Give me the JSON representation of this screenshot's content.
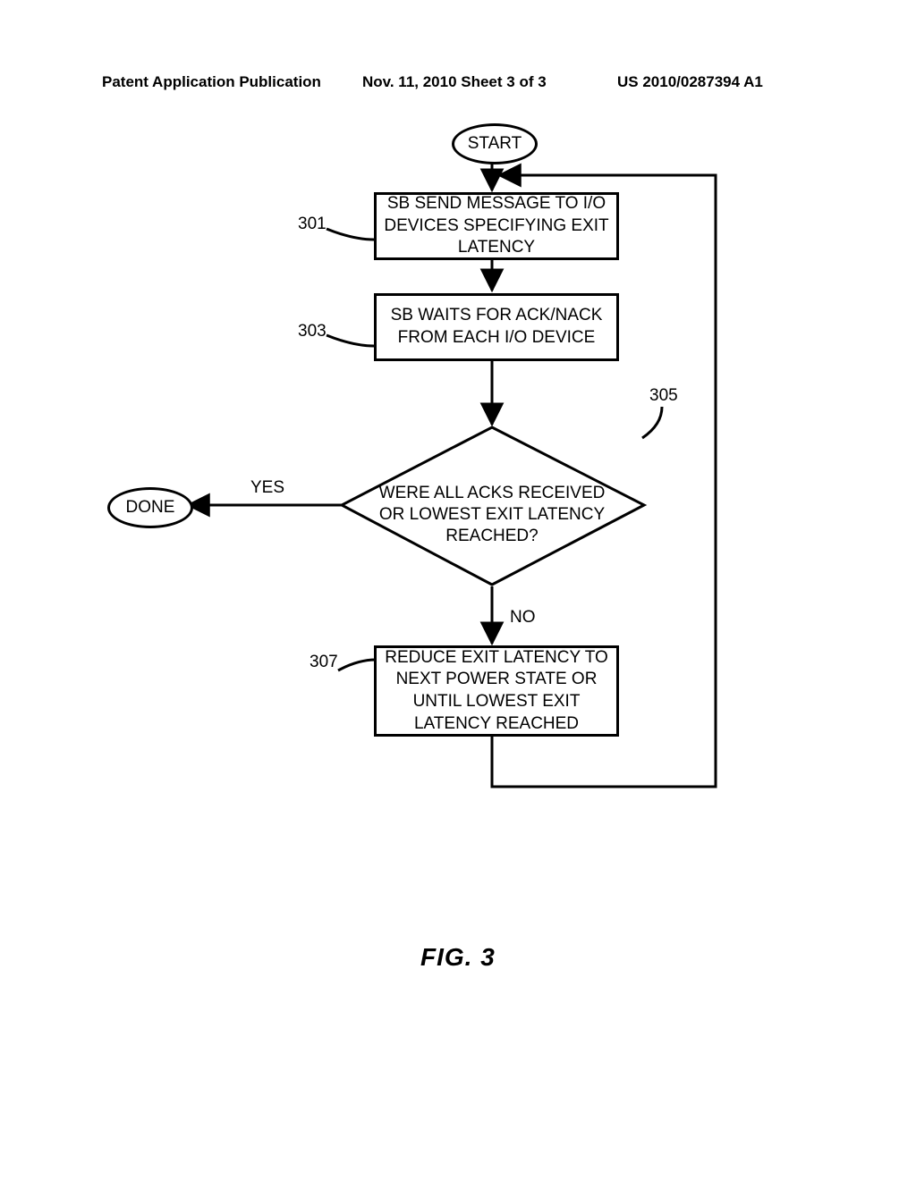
{
  "header": {
    "left": "Patent Application Publication",
    "center": "Nov. 11, 2010  Sheet 3 of 3",
    "right": "US 2010/0287394 A1"
  },
  "terminals": {
    "start": "START",
    "done": "DONE"
  },
  "steps": {
    "s301": {
      "ref": "301",
      "text": "SB SEND MESSAGE TO I/O DEVICES SPECIFYING EXIT LATENCY"
    },
    "s303": {
      "ref": "303",
      "text": "SB WAITS FOR ACK/NACK FROM EACH I/O DEVICE"
    },
    "s305": {
      "ref": "305",
      "text": "WERE ALL ACKS RECEIVED OR LOWEST EXIT LATENCY REACHED?"
    },
    "s307": {
      "ref": "307",
      "text": "REDUCE EXIT LATENCY TO NEXT POWER STATE OR UNTIL LOWEST EXIT LATENCY REACHED"
    }
  },
  "branches": {
    "yes": "YES",
    "no": "NO"
  },
  "figure": "FIG. 3"
}
